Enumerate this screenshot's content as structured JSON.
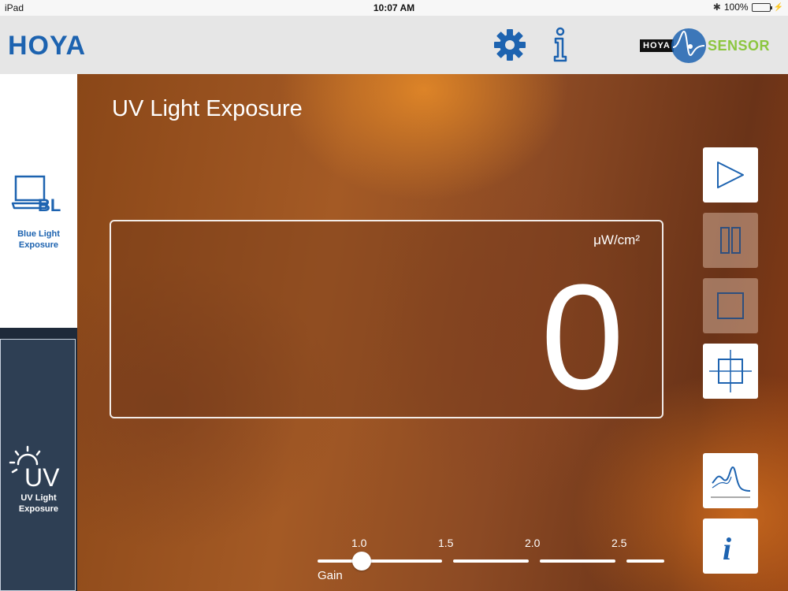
{
  "status": {
    "device": "iPad",
    "time": "10:07 AM",
    "battery": "100%"
  },
  "header": {
    "logo": "HOYA",
    "sensor_brand": "HOYA",
    "sensor_text": "SENSOR"
  },
  "sidebar": {
    "items": [
      {
        "icon_text": "BL",
        "label": "Blue Light Exposure",
        "icon": "laptop-icon",
        "selected": false
      },
      {
        "icon_text": "UV",
        "label": "UV Light Exposure",
        "icon": "sun-icon",
        "selected": true
      }
    ]
  },
  "main": {
    "title": "UV Light Exposure",
    "readout": {
      "unit": "μW/cm²",
      "value": "0"
    },
    "controls": [
      {
        "name": "play",
        "icon": "play-icon",
        "enabled": true
      },
      {
        "name": "pause",
        "icon": "pause-icon",
        "enabled": false
      },
      {
        "name": "stop",
        "icon": "stop-icon",
        "enabled": false
      },
      {
        "name": "calibrate",
        "icon": "crosshair-icon",
        "enabled": true
      },
      {
        "name": "spectrum",
        "icon": "spectrum-graph-icon",
        "enabled": true
      },
      {
        "name": "info",
        "icon": "info-icon",
        "enabled": true
      }
    ],
    "gain": {
      "label": "Gain",
      "ticks": [
        "1.0",
        "1.5",
        "2.0",
        "2.5"
      ],
      "value": 1.0
    }
  },
  "colors": {
    "accent": "#1d63b0",
    "sensor_green": "#8cc63f",
    "sidebar_dark": "#2e3f54"
  }
}
